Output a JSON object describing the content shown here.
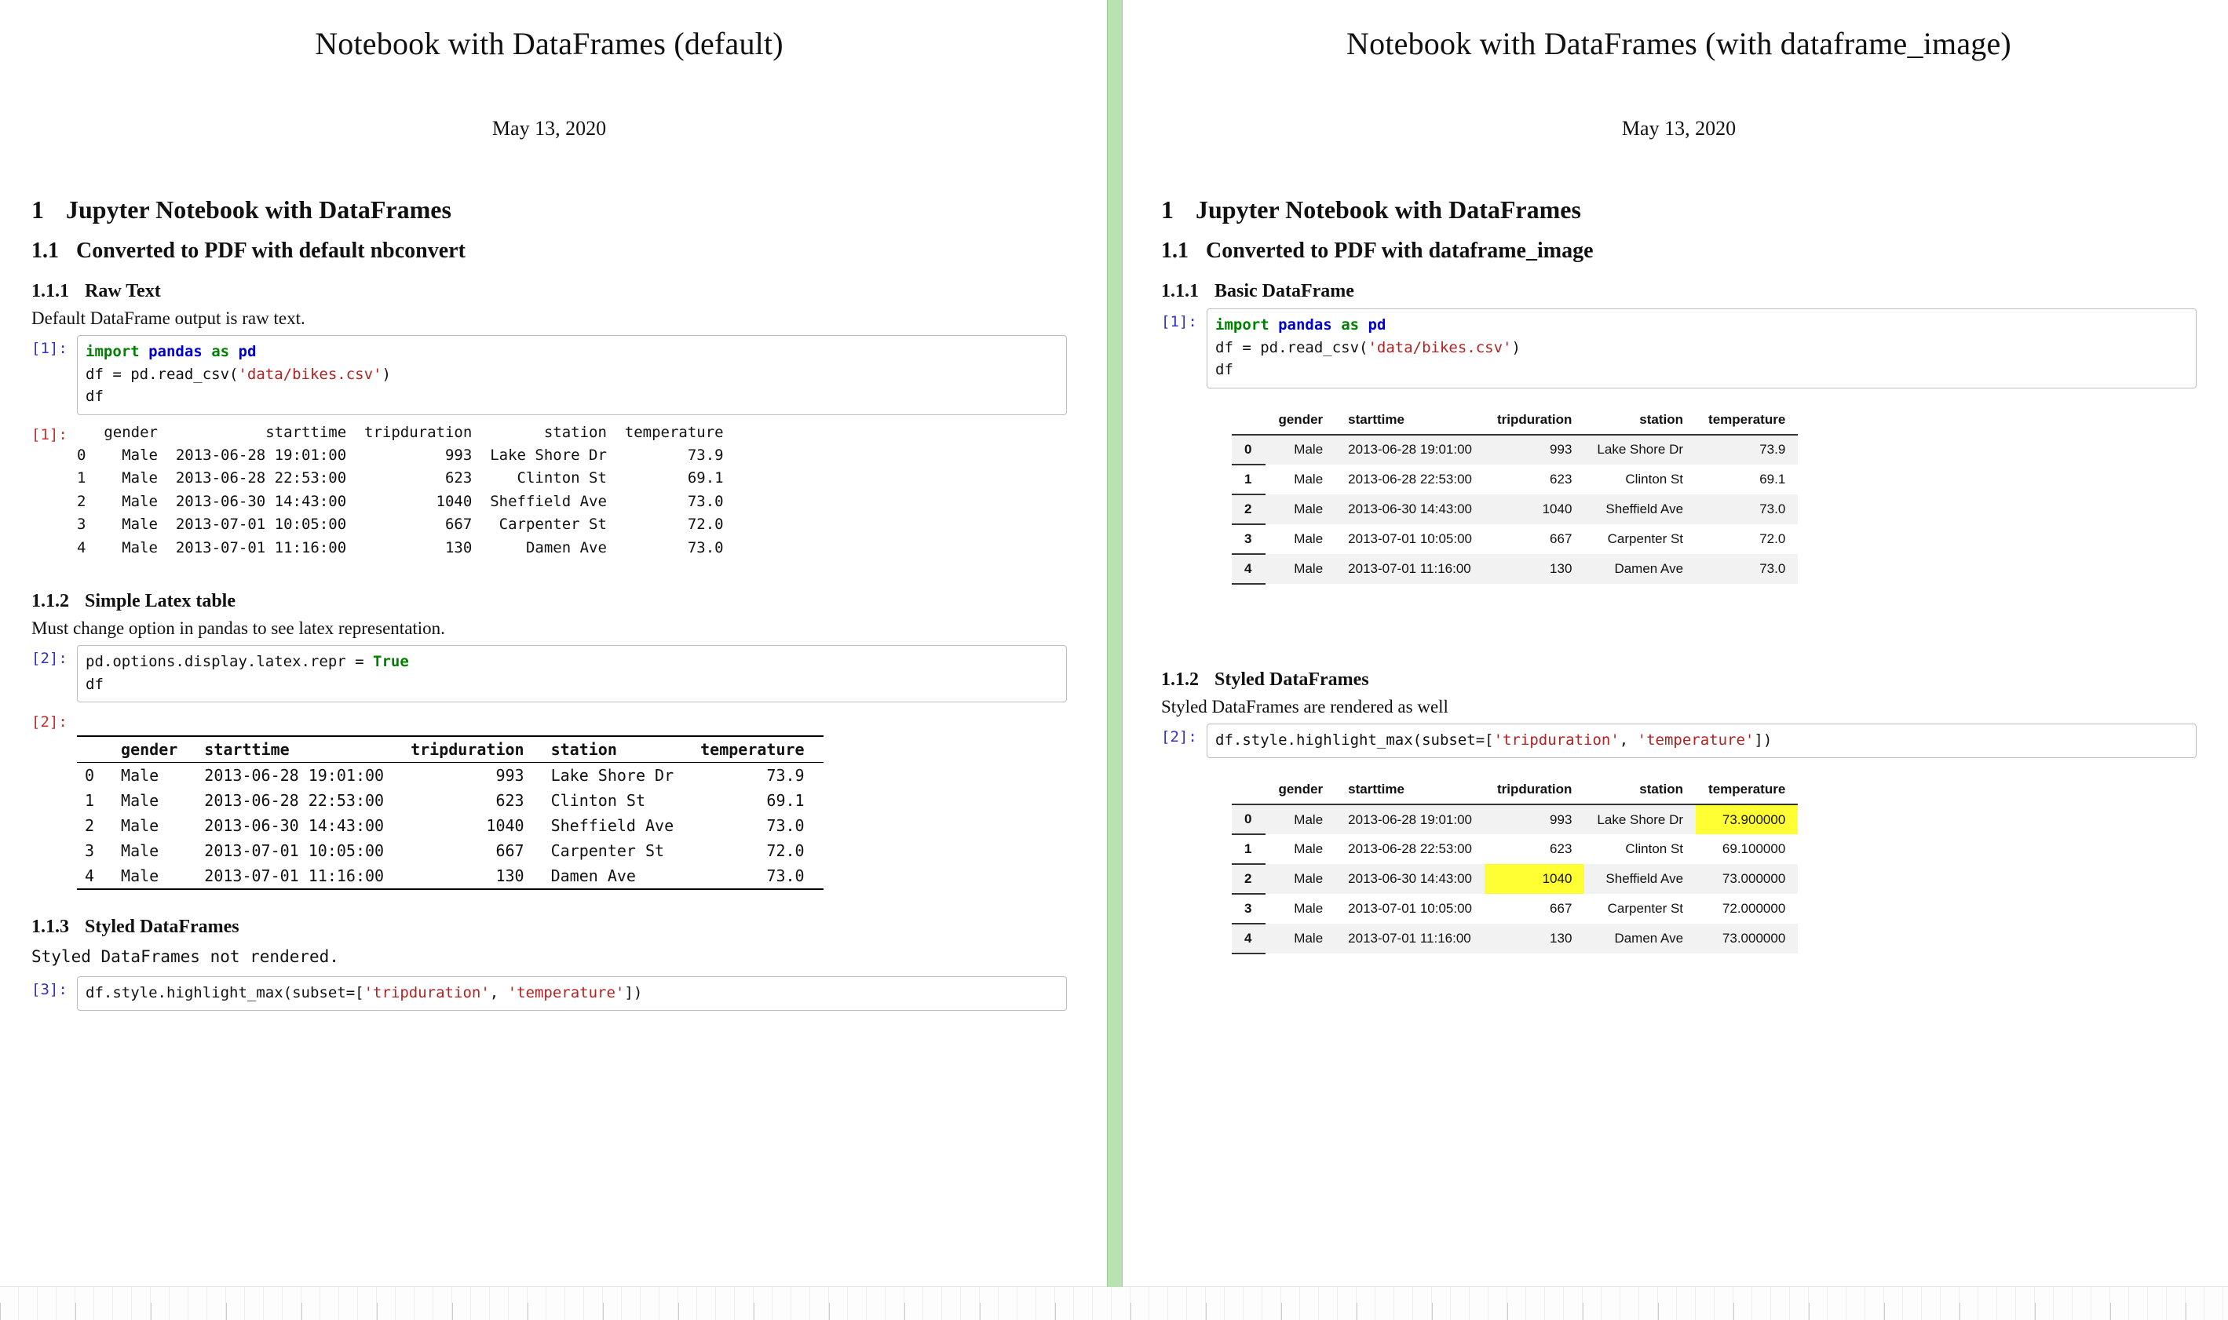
{
  "left": {
    "title": "Notebook with DataFrames (default)",
    "date": "May 13, 2020",
    "h1_num": "1",
    "h1": "Jupyter Notebook with DataFrames",
    "h2_num": "1.1",
    "h2": "Converted to PDF with default nbconvert",
    "sec1_num": "1.1.1",
    "sec1_title": "Raw Text",
    "sec1_para": "Default DataFrame output is raw text.",
    "cell1_prompt": "[1]:",
    "cell1_code_kw1": "import",
    "cell1_code_mod1": "pandas",
    "cell1_code_kw2": "as",
    "cell1_code_mod2": "pd",
    "cell1_line2a": "df = pd.read_csv(",
    "cell1_line2_str": "'data/bikes.csv'",
    "cell1_line2b": ")",
    "cell1_line3": "df",
    "out1_prompt": "[1]:",
    "raw_text_output": "   gender            starttime  tripduration        station  temperature\n0    Male  2013-06-28 19:01:00           993  Lake Shore Dr         73.9\n1    Male  2013-06-28 22:53:00           623     Clinton St         69.1\n2    Male  2013-06-30 14:43:00          1040  Sheffield Ave         73.0\n3    Male  2013-07-01 10:05:00           667   Carpenter St         72.0\n4    Male  2013-07-01 11:16:00           130      Damen Ave         73.0",
    "sec2_num": "1.1.2",
    "sec2_title": "Simple Latex table",
    "sec2_para": "Must change option in pandas to see latex representation.",
    "cell2_prompt": "[2]:",
    "cell2_line1a": "pd.options.display.latex.repr = ",
    "cell2_line1_bool": "True",
    "cell2_line2": "df",
    "out2_prompt": "[2]:",
    "latex_headers": [
      "",
      "gender",
      "starttime",
      "tripduration",
      "station",
      "temperature"
    ],
    "latex_rows": [
      [
        "0",
        "Male",
        "2013-06-28 19:01:00",
        "993",
        "Lake Shore Dr",
        "73.9"
      ],
      [
        "1",
        "Male",
        "2013-06-28 22:53:00",
        "623",
        "Clinton St",
        "69.1"
      ],
      [
        "2",
        "Male",
        "2013-06-30 14:43:00",
        "1040",
        "Sheffield Ave",
        "73.0"
      ],
      [
        "3",
        "Male",
        "2013-07-01 10:05:00",
        "667",
        "Carpenter St",
        "72.0"
      ],
      [
        "4",
        "Male",
        "2013-07-01 11:16:00",
        "130",
        "Damen Ave",
        "73.0"
      ]
    ],
    "sec3_num": "1.1.3",
    "sec3_title": "Styled DataFrames",
    "sec3_para": "Styled DataFrames not rendered.",
    "cell3_prompt": "[3]:",
    "cell3_code_a": "df.style.highlight_max(subset=[",
    "cell3_str1": "'tripduration'",
    "cell3_sep": ", ",
    "cell3_str2": "'temperature'",
    "cell3_code_b": "])"
  },
  "right": {
    "title": "Notebook with DataFrames (with dataframe_image)",
    "date": "May 13, 2020",
    "h1_num": "1",
    "h1": "Jupyter Notebook with DataFrames",
    "h2_num": "1.1",
    "h2": "Converted to PDF with dataframe_image",
    "sec1_num": "1.1.1",
    "sec1_title": "Basic DataFrame",
    "cell1_prompt": "[1]:",
    "cell1_code_kw1": "import",
    "cell1_code_mod1": "pandas",
    "cell1_code_kw2": "as",
    "cell1_code_mod2": "pd",
    "cell1_line2a": "df = pd.read_csv(",
    "cell1_line2_str": "'data/bikes.csv'",
    "cell1_line2b": ")",
    "cell1_line3": "df",
    "df1_headers": [
      "",
      "gender",
      "starttime",
      "tripduration",
      "station",
      "temperature"
    ],
    "df1_rows": [
      [
        "0",
        "Male",
        "2013-06-28 19:01:00",
        "993",
        "Lake Shore Dr",
        "73.9"
      ],
      [
        "1",
        "Male",
        "2013-06-28 22:53:00",
        "623",
        "Clinton St",
        "69.1"
      ],
      [
        "2",
        "Male",
        "2013-06-30 14:43:00",
        "1040",
        "Sheffield Ave",
        "73.0"
      ],
      [
        "3",
        "Male",
        "2013-07-01 10:05:00",
        "667",
        "Carpenter St",
        "72.0"
      ],
      [
        "4",
        "Male",
        "2013-07-01 11:16:00",
        "130",
        "Damen Ave",
        "73.0"
      ]
    ],
    "sec2_num": "1.1.2",
    "sec2_title": "Styled DataFrames",
    "sec2_para": "Styled DataFrames are rendered as well",
    "cell2_prompt": "[2]:",
    "cell2_code_a": "df.style.highlight_max(subset=[",
    "cell2_str1": "'tripduration'",
    "cell2_sep": ", ",
    "cell2_str2": "'temperature'",
    "cell2_code_b": "])",
    "df2_headers": [
      "",
      "gender",
      "starttime",
      "tripduration",
      "station",
      "temperature"
    ],
    "df2_rows": [
      [
        "0",
        "Male",
        "2013-06-28 19:01:00",
        "993",
        "Lake Shore Dr",
        "73.900000"
      ],
      [
        "1",
        "Male",
        "2013-06-28 22:53:00",
        "623",
        "Clinton St",
        "69.100000"
      ],
      [
        "2",
        "Male",
        "2013-06-30 14:43:00",
        "1040",
        "Sheffield Ave",
        "73.000000"
      ],
      [
        "3",
        "Male",
        "2013-07-01 10:05:00",
        "667",
        "Carpenter St",
        "72.000000"
      ],
      [
        "4",
        "Male",
        "2013-07-01 11:16:00",
        "130",
        "Damen Ave",
        "73.000000"
      ]
    ],
    "df2_highlights": {
      "tripduration_row": 2,
      "temperature_row": 0
    }
  }
}
